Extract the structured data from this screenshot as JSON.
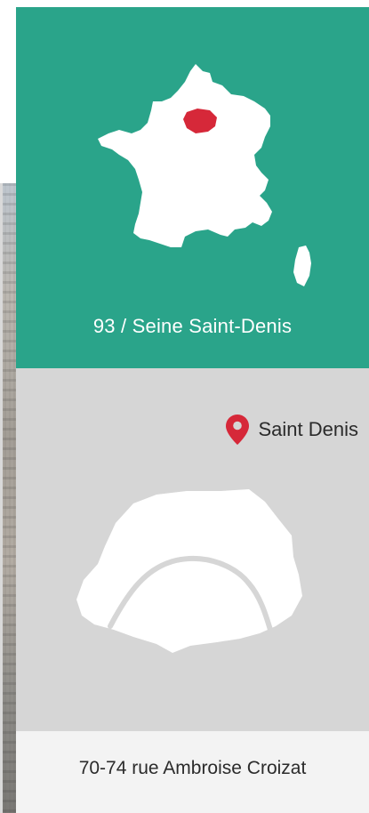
{
  "region": {
    "label": "93 / Seine Saint-Denis",
    "background_color": "#2aa48a",
    "map_icon": "france-map-icon",
    "highlight_color": "#d62839"
  },
  "city": {
    "label": "Saint Denis",
    "background_color": "#d6d6d6",
    "pin_icon": "location-pin-icon",
    "pin_color": "#d62839",
    "map_icon": "paris-map-icon"
  },
  "address": {
    "label": "70-74 rue Ambroise Croizat",
    "background_color": "#f3f3f3"
  }
}
